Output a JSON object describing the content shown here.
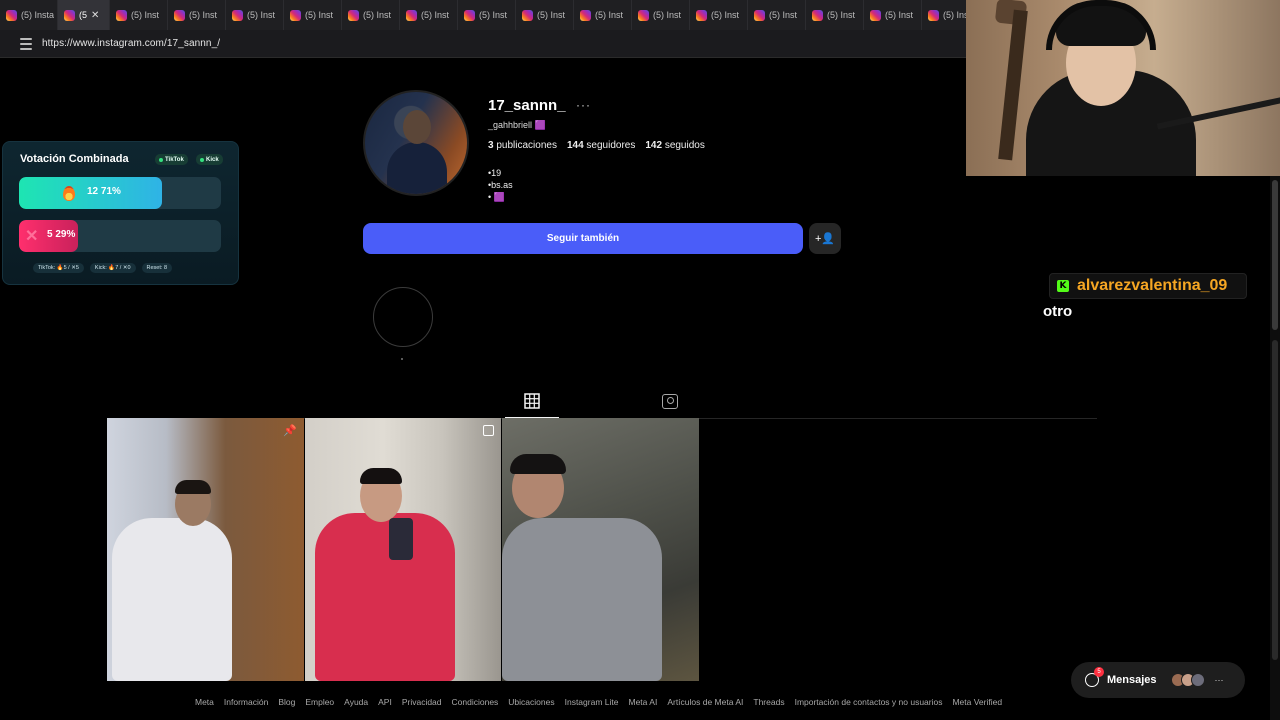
{
  "browser": {
    "tabs": [
      {
        "label": "(5) Insta",
        "active": false
      },
      {
        "label": "(5",
        "active": true
      },
      {
        "label": "(5) Inst",
        "active": false
      },
      {
        "label": "(5) Inst",
        "active": false
      },
      {
        "label": "(5) Inst",
        "active": false
      },
      {
        "label": "(5) Inst",
        "active": false
      },
      {
        "label": "(5) Inst",
        "active": false
      },
      {
        "label": "(5) Inst",
        "active": false
      },
      {
        "label": "(5) Inst",
        "active": false
      },
      {
        "label": "(5) Inst",
        "active": false
      },
      {
        "label": "(5) Inst",
        "active": false
      },
      {
        "label": "(5) Inst",
        "active": false
      },
      {
        "label": "(5) Inst",
        "active": false
      },
      {
        "label": "(5) Inst",
        "active": false
      },
      {
        "label": "(5) Inst",
        "active": false
      },
      {
        "label": "(5) Inst",
        "active": false
      },
      {
        "label": "(5) Inst",
        "active": false
      }
    ],
    "close_glyph": "✕",
    "url": "https://www.instagram.com/17_sannn_/"
  },
  "profile": {
    "username": "17_sannn_",
    "more_glyph": "···",
    "fullname": "_gahhbriell 🟪",
    "stats": {
      "posts_count": "3",
      "posts_label": "publicaciones",
      "followers_count": "144",
      "followers_label": "seguidores",
      "following_count": "142",
      "following_label": "seguidos"
    },
    "bio": [
      "•19",
      "•bs.as",
      "• 🟪"
    ],
    "follow_button": "Seguir también",
    "suggest_glyph": "+👤"
  },
  "posts": [
    {
      "pinned": true
    },
    {
      "multi": true
    },
    {}
  ],
  "footer_links": [
    "Meta",
    "Información",
    "Blog",
    "Empleo",
    "Ayuda",
    "API",
    "Privacidad",
    "Condiciones",
    "Ubicaciones",
    "Instagram Lite",
    "Meta AI",
    "Artículos de Meta AI",
    "Threads",
    "Importación de contactos y no usuarios",
    "Meta Verified"
  ],
  "vote_overlay": {
    "title": "Votación Combinada",
    "badges": [
      "TikTok",
      "Kick"
    ],
    "option_a": {
      "label": "12  71%",
      "votes": 12,
      "percent": 71,
      "color": "#1ee5b2"
    },
    "option_b": {
      "label": "5  29%",
      "votes": 5,
      "percent": 29,
      "color": "#ff2f6d",
      "x_glyph": "✕"
    },
    "footer": {
      "tiktok": "TikTok: 🔥5 / ✕5",
      "kick": "Kick: 🔥7 / ✕0",
      "reset": "Reset: 8"
    }
  },
  "chat": {
    "platform_glyph": "K",
    "username": "alvarezvalentina_09",
    "message": "otro"
  },
  "messages_pill": {
    "label": "Mensajes",
    "badge": "5",
    "more_glyph": "···"
  }
}
